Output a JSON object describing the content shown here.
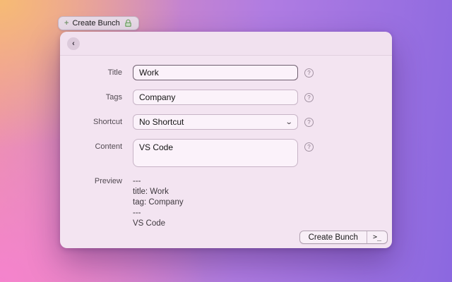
{
  "background": {
    "corner_colors": {
      "top_left": "#f6bb74",
      "top_right": "#9b79e8",
      "bottom_left": "#f583cd",
      "bottom_right": "#8b68e0"
    }
  },
  "tab": {
    "label": "Create Bunch",
    "left_icon": "plus-icon",
    "right_icon": "lock-icon",
    "plus_glyph": "+",
    "lock_color": "#76a86a"
  },
  "window": {
    "back_glyph": "‹",
    "help_glyph": "?",
    "chevron_glyph": "⌄",
    "form": {
      "title": {
        "label": "Title",
        "value": "Work"
      },
      "tags": {
        "label": "Tags",
        "value": "Company"
      },
      "shortcut": {
        "label": "Shortcut",
        "value": "No Shortcut"
      },
      "content": {
        "label": "Content",
        "value": "VS Code"
      }
    },
    "preview": {
      "label": "Preview",
      "lines": [
        "---",
        "title: Work",
        "tag: Company",
        "---",
        "VS Code"
      ]
    },
    "footer": {
      "create_label": "Create Bunch",
      "terminal_label": "&gt;_",
      "terminal_text": ">_"
    }
  }
}
